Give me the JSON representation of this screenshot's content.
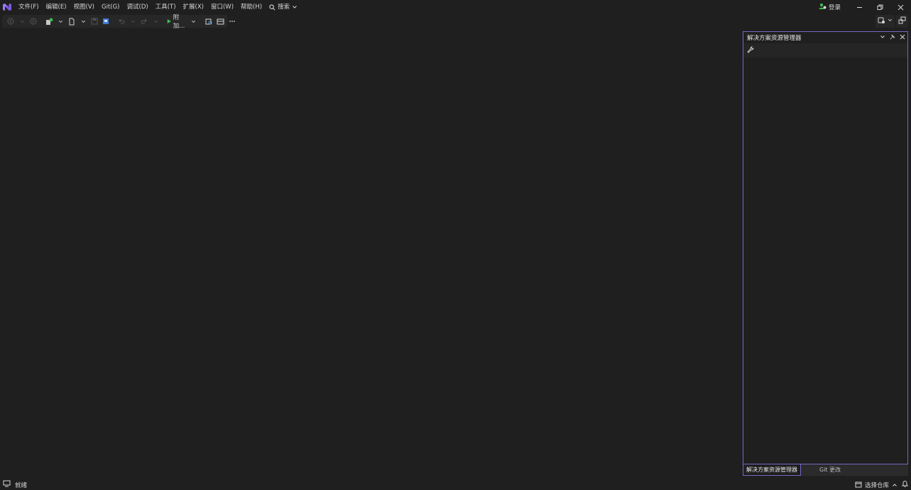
{
  "menu": {
    "items": [
      {
        "label": "文件(F)"
      },
      {
        "label": "编辑(E)"
      },
      {
        "label": "视图(V)"
      },
      {
        "label": "Git(G)"
      },
      {
        "label": "调试(D)"
      },
      {
        "label": "工具(T)"
      },
      {
        "label": "扩展(X)"
      },
      {
        "label": "窗口(W)"
      },
      {
        "label": "帮助(H)"
      }
    ],
    "search_label": "搜索"
  },
  "account": {
    "login_label": "登录"
  },
  "toolbar": {
    "attach_label": "附加..."
  },
  "solution_explorer": {
    "title": "解决方案资源管理器"
  },
  "panel_tabs": [
    {
      "label": "解决方案资源管理器"
    },
    {
      "label": "Git 更改"
    }
  ],
  "status": {
    "ready_label": "就绪",
    "select_repo_label": "选择仓库"
  },
  "colors": {
    "background": "#1f1f1f",
    "accent": "#7567c2",
    "play_green": "#3fb950"
  }
}
